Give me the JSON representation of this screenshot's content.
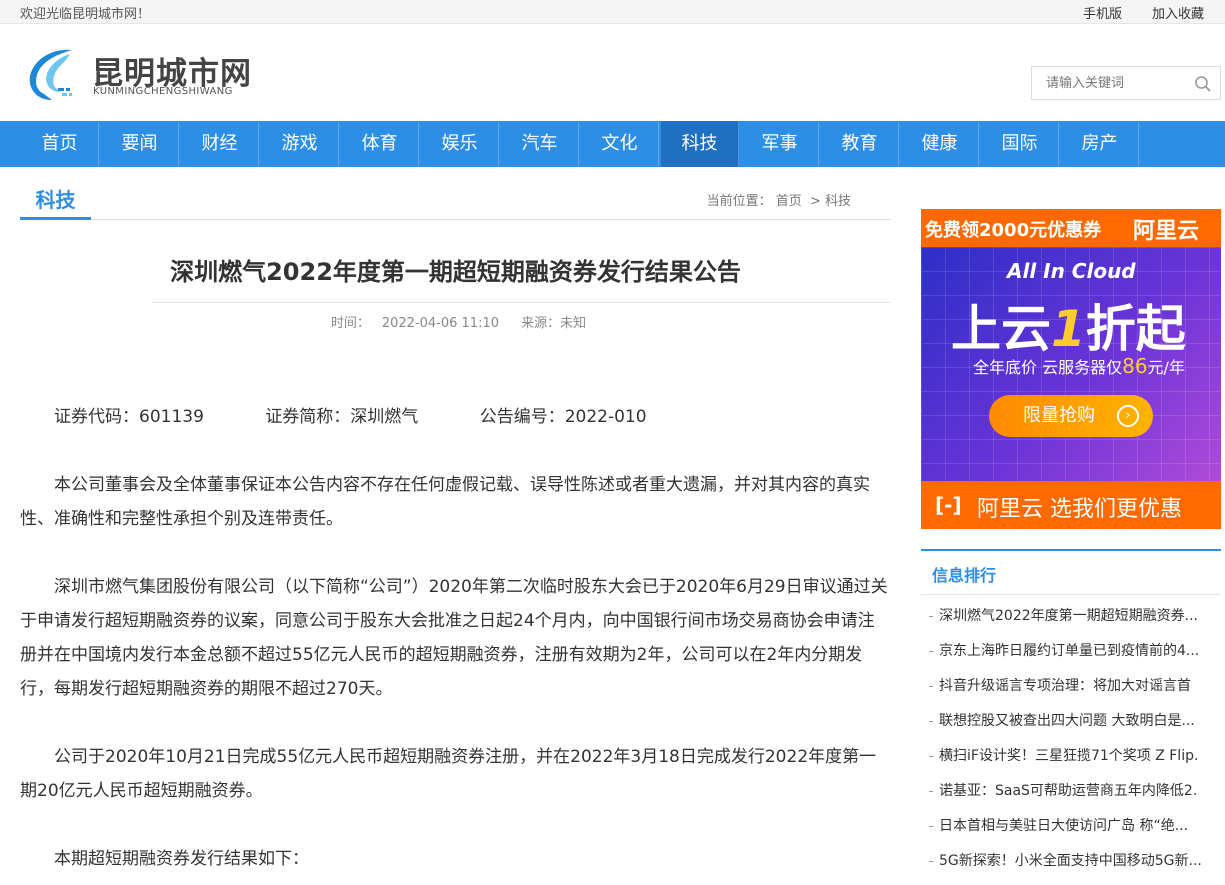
{
  "topbar": {
    "welcome": "欢迎光临昆明城市网！",
    "mobile": "手机版",
    "favorite": "加入收藏"
  },
  "logo": {
    "name": "昆明城市网",
    "pinyin": "KUNMINGCHENGSHIWANG"
  },
  "search": {
    "placeholder": "请输入关键词"
  },
  "nav": [
    "首页",
    "要闻",
    "财经",
    "游戏",
    "体育",
    "娱乐",
    "汽车",
    "文化",
    "科技",
    "军事",
    "教育",
    "健康",
    "国际",
    "房产"
  ],
  "nav_active": "科技",
  "section": {
    "title": "科技",
    "crumb_label": "当前位置：",
    "crumb_home": "首页",
    "crumb_sep": ">",
    "crumb_current": "科技"
  },
  "article": {
    "title": "深圳燃气2022年度第一期超短期融资券发行结果公告",
    "time_label": "时间：",
    "time": "2022-04-06 11:10",
    "source": "来源：未知",
    "codes": [
      "证券代码：601139",
      "证券简称：深圳燃气",
      "公告编号：2022-010"
    ],
    "paragraphs": [
      "本公司董事会及全体董事保证本公告内容不存在任何虚假记载、误导性陈述或者重大遗漏，并对其内容的真实性、准确性和完整性承担个别及连带责任。",
      "深圳市燃气集团股份有限公司（以下简称“公司”）2020年第二次临时股东大会已于2020年6月29日审议通过关于申请发行超短期融资券的议案，同意公司于股东大会批准之日起24个月内，向中国银行间市场交易商协会申请注册并在中国境内发行本金总额不超过55亿元人民币的超短期融资券，注册有效期为2年，公司可以在2年内分期发行，每期发行超短期融资券的期限不超过270天。",
      "公司于2020年10月21日完成55亿元人民币超短期融资券注册，并在2022年3月18日完成发行2022年度第一期20亿元人民币超短期融资券。",
      "本期超短期融资券发行结果如下："
    ]
  },
  "ad": {
    "coupon": "免费领2000元优惠券",
    "brand": "阿里云",
    "cloud": "All In Cloud",
    "headline_a": "上云",
    "headline_b": "1",
    "headline_c": "折起",
    "sub_a": "全年底价  云服务器仅",
    "sub_price": "86",
    "sub_b": "元/年",
    "button": "限量抢购",
    "footer_mark": "[-]",
    "footer": "阿里云 选我们更优惠"
  },
  "ranking": {
    "title": "信息排行",
    "items": [
      "深圳燃气2022年度第一期超短期融资券...",
      "京东上海昨日履约订单量已到疫情前的4...",
      "抖音升级谣言专项治理：将加大对谣言首",
      "联想控股又被查出四大问题 大致明白是...",
      "横扫iF设计奖！三星狂揽71个奖项 Z Flip.",
      "诺基亚：SaaS可帮助运营商五年内降低2.",
      "日本首相与美驻日大使访问广岛 称“绝...",
      "5G新探索！小米全面支持中国移动5G新..."
    ]
  },
  "colors": {
    "accent": "#2d8ee6",
    "nav_active": "#1f6fc2",
    "ad_orange": "#ff6a00"
  }
}
